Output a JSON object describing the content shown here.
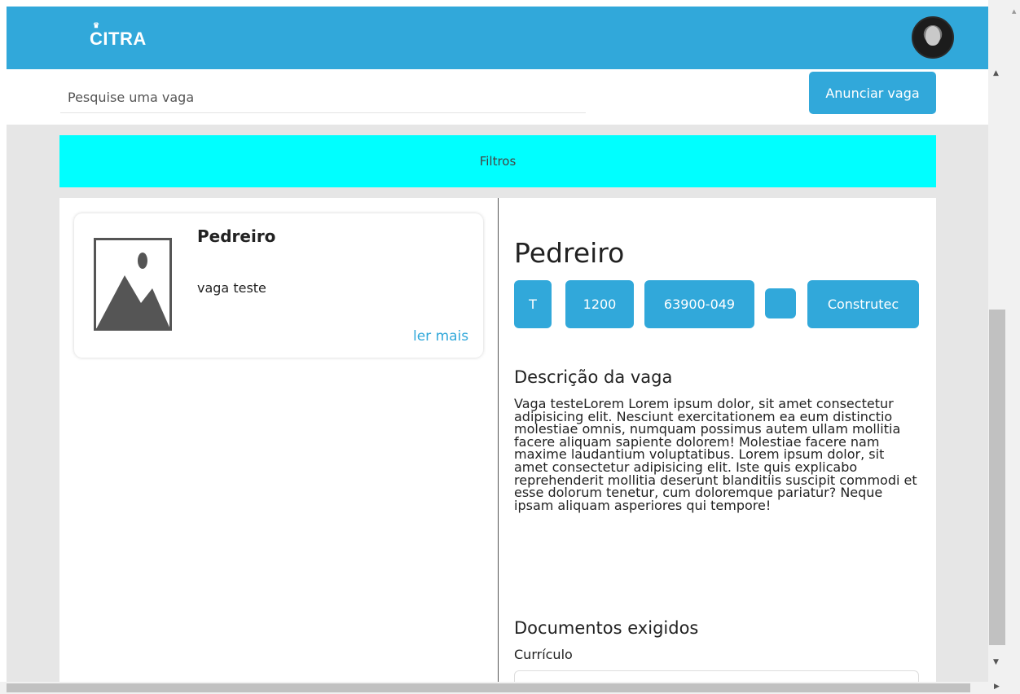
{
  "header": {
    "logo": "CITRA",
    "logo_mark": "♛"
  },
  "search": {
    "placeholder": "Pesquise uma vaga",
    "button_label": "Anunciar vaga"
  },
  "filters": {
    "label": "Filtros"
  },
  "job_list": {
    "items": [
      {
        "title": "Pedreiro",
        "description": "vaga teste",
        "link_label": "ler mais"
      }
    ]
  },
  "detail": {
    "title": "Pedreiro",
    "chips": [
      "T",
      "1200",
      "63900-049",
      "",
      "Construtec"
    ],
    "description_heading": "Descrição da vaga",
    "description": "Vaga testeLorem Lorem ipsum dolor, sit amet consectetur adipisicing elit. Nesciunt exercitationem ea eum distinctio molestiae omnis, numquam possimus autem ullam mollitia facere aliquam sapiente dolorem! Molestiae facere nam maxime laudantium voluptatibus. Lorem ipsum dolor, sit amet consectetur adipisicing elit. Iste quis explicabo reprehenderit mollitia deserunt blanditiis suscipit commodi et esse dolorum tenetur, cum doloremque pariatur? Neque ipsam aliquam asperiores qui tempore!",
    "documents_heading": "Documentos exigidos",
    "documents": [
      "Currículo"
    ]
  },
  "colors": {
    "primary": "#31a8da",
    "filters_bg": "#00ffff",
    "page_bg": "#e6e6e6"
  },
  "icons": {
    "scroll_up": "▲",
    "scroll_down": "▼",
    "scroll_right": "▶"
  }
}
